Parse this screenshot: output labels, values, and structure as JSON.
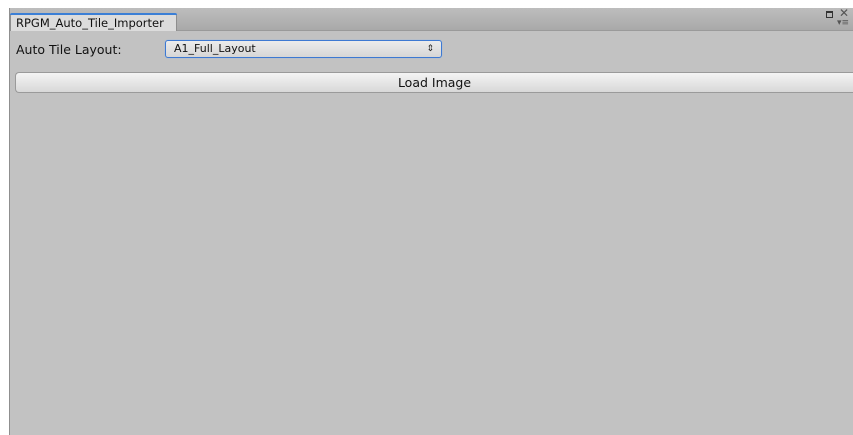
{
  "window": {
    "tab_title": "RPGM_Auto_Tile_Importer"
  },
  "icons": {
    "maximize": "maximize-icon",
    "close": "close-icon",
    "tab_menu": "tab-menu-icon",
    "dropdown_arrows": "dropdown-arrows-icon"
  },
  "layout_field": {
    "label": "Auto Tile Layout:",
    "selected_value": "A1_Full_Layout"
  },
  "actions": {
    "load_label": "Load Image"
  },
  "colors": {
    "panel_background": "#c2c2c2",
    "focus_accent": "#3d79d2",
    "tab_background": "#dcdcdc"
  }
}
